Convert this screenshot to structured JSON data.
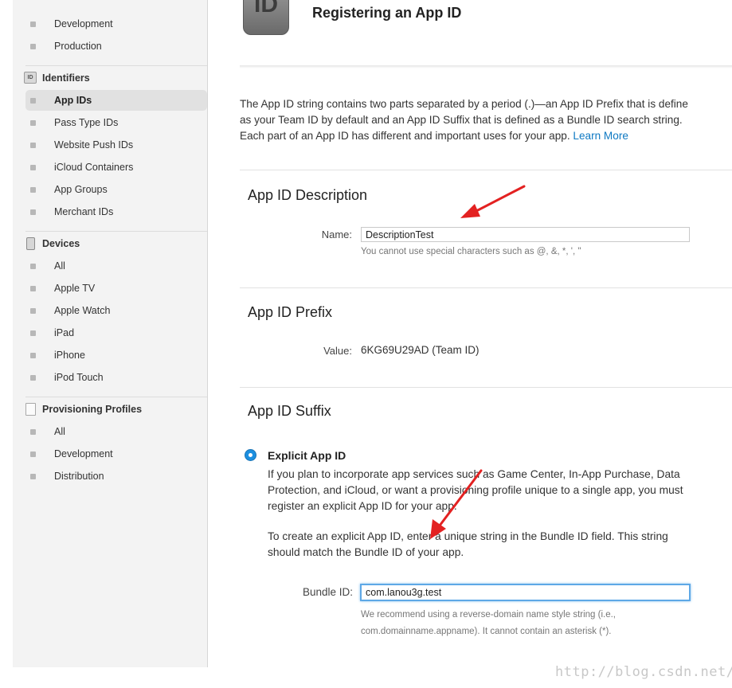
{
  "sidebar": {
    "top_items": [
      {
        "label": "Development"
      },
      {
        "label": "Production"
      }
    ],
    "identifiers": {
      "heading": "Identifiers",
      "icon_text": "ID",
      "items": [
        {
          "label": "App IDs"
        },
        {
          "label": "Pass Type IDs"
        },
        {
          "label": "Website Push IDs"
        },
        {
          "label": "iCloud Containers"
        },
        {
          "label": "App Groups"
        },
        {
          "label": "Merchant IDs"
        }
      ]
    },
    "devices": {
      "heading": "Devices",
      "items": [
        {
          "label": "All"
        },
        {
          "label": "Apple TV"
        },
        {
          "label": "Apple Watch"
        },
        {
          "label": "iPad"
        },
        {
          "label": "iPhone"
        },
        {
          "label": "iPod Touch"
        }
      ]
    },
    "profiles": {
      "heading": "Provisioning Profiles",
      "items": [
        {
          "label": "All"
        },
        {
          "label": "Development"
        },
        {
          "label": "Distribution"
        }
      ]
    }
  },
  "header": {
    "icon_text": "ID",
    "title": "Registering an App ID"
  },
  "intro": {
    "line1": "The App ID string contains two parts separated by a period (.)—an App ID Prefix that is define",
    "line2": "as your Team ID by default and an App ID Suffix that is defined as a Bundle ID search string.",
    "line3": "Each part of an App ID has different and important uses for your app.",
    "link": "Learn More"
  },
  "description": {
    "heading": "App ID Description",
    "name_label": "Name:",
    "name_value": "DescriptionTest",
    "hint": "You cannot use special characters such as @, &, *, ', \""
  },
  "prefix": {
    "heading": "App ID Prefix",
    "value_label": "Value:",
    "value": "6KG69U29AD (Team ID)"
  },
  "suffix": {
    "heading": "App ID Suffix",
    "explicit_label": "Explicit App ID",
    "para1_line1": "If you plan to incorporate app services such as Game Center, In-App Purchase, Data",
    "para1_line2": "Protection, and iCloud, or want a provisioning profile unique to a single app, you must",
    "para1_line3": "register an explicit App ID for your app.",
    "para2_line1": "To create an explicit App ID, enter a unique string in the Bundle ID field. This string",
    "para2_line2": "should match the Bundle ID of your app.",
    "bundle_label": "Bundle ID:",
    "bundle_value": "com.lanou3g.test",
    "hint_line1": "We recommend using a reverse-domain name style string (i.e.,",
    "hint_line2": "com.domainname.appname). It cannot contain an asterisk (*)."
  },
  "watermark": "http://blog.csdn.net/",
  "colors": {
    "link": "#0e79c3",
    "radio": "#1c8fe0",
    "focus": "#5ea8e6",
    "arrow": "#e32121"
  }
}
